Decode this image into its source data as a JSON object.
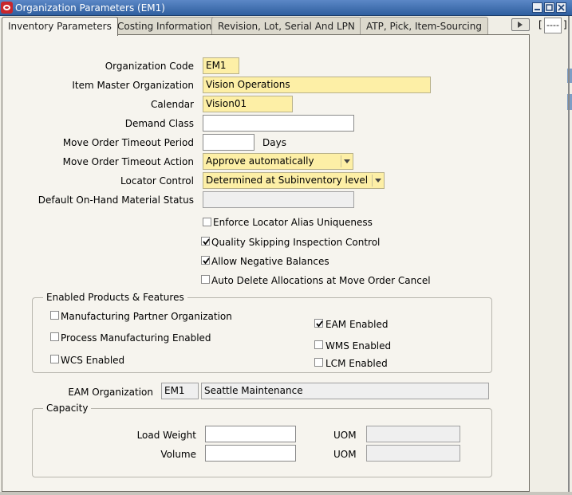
{
  "window": {
    "title": "Organization Parameters (EM1)"
  },
  "tabs": [
    {
      "label": "Inventory Parameters",
      "active": true
    },
    {
      "label": "Costing Information",
      "active": false
    },
    {
      "label": "Revision, Lot, Serial And LPN",
      "active": false
    },
    {
      "label": "ATP, Pick, Item-Sourcing",
      "active": false
    }
  ],
  "tab_list": {
    "open_bracket": "[",
    "value": "----",
    "close_bracket": "]"
  },
  "form": {
    "organization_code": {
      "label": "Organization Code",
      "value": "EM1"
    },
    "item_master_org": {
      "label": "Item Master Organization",
      "value": "Vision Operations"
    },
    "calendar": {
      "label": "Calendar",
      "value": "Vision01"
    },
    "demand_class": {
      "label": "Demand Class",
      "value": ""
    },
    "move_order_timeout_period": {
      "label": "Move Order Timeout Period",
      "value": "",
      "unit": "Days"
    },
    "move_order_timeout_action": {
      "label": "Move Order Timeout Action",
      "value": "Approve automatically"
    },
    "locator_control": {
      "label": "Locator Control",
      "value": "Determined at Subinventory level"
    },
    "default_onhand_status": {
      "label": "Default On-Hand Material Status",
      "value": ""
    }
  },
  "checkboxes": {
    "enforce_locator_alias": {
      "label": "Enforce Locator Alias Uniqueness",
      "checked": false
    },
    "quality_skipping": {
      "label": "Quality Skipping Inspection Control",
      "checked": true
    },
    "allow_negative": {
      "label": "Allow Negative Balances",
      "checked": true
    },
    "auto_delete_alloc": {
      "label": "Auto Delete Allocations at Move Order Cancel",
      "checked": false
    }
  },
  "enabled_products": {
    "title": "Enabled Products & Features",
    "manufacturing_partner": {
      "label": "Manufacturing Partner Organization",
      "checked": false
    },
    "process_manufacturing": {
      "label": "Process Manufacturing Enabled",
      "checked": false
    },
    "wcs": {
      "label": "WCS Enabled",
      "checked": false
    },
    "eam": {
      "label": "EAM Enabled",
      "checked": true
    },
    "wms": {
      "label": "WMS Enabled",
      "checked": false
    },
    "lcm": {
      "label": "LCM Enabled",
      "checked": false
    }
  },
  "eam_org": {
    "label": "EAM Organization",
    "code": "EM1",
    "name": "Seattle Maintenance"
  },
  "capacity": {
    "title": "Capacity",
    "load_weight": {
      "label": "Load Weight",
      "value": "",
      "uom_label": "UOM",
      "uom": ""
    },
    "volume": {
      "label": "Volume",
      "value": "",
      "uom_label": "UOM",
      "uom": ""
    }
  },
  "colors": {
    "titlebar": "#3f6eb3",
    "required_field": "#fdefa6",
    "panel": "#f6f4ee"
  }
}
